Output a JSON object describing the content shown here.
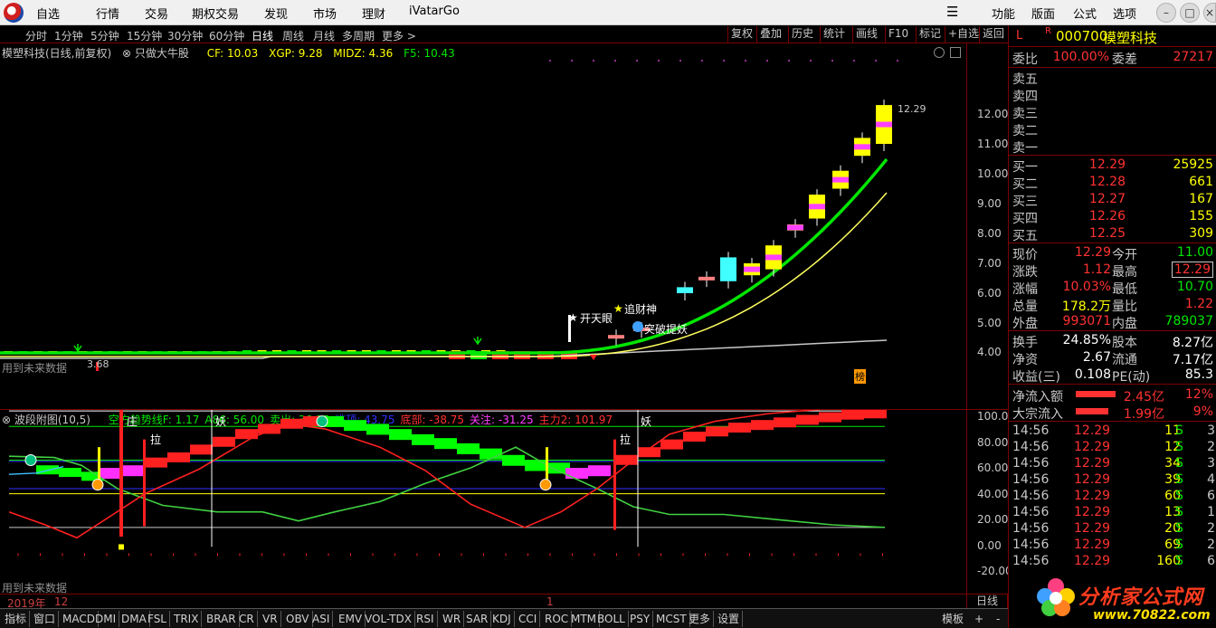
{
  "menu": {
    "items": [
      "自选",
      "行情",
      "交易",
      "期权交易",
      "发现",
      "市场",
      "理财",
      "iVatarGo"
    ],
    "right_items": [
      "功能",
      "版面",
      "公式",
      "选项"
    ]
  },
  "periods": {
    "items": [
      "分时",
      "1分钟",
      "5分钟",
      "15分钟",
      "30分钟",
      "60分钟",
      "日线",
      "周线",
      "月线",
      "多周期",
      "更多 >"
    ],
    "active": "日线"
  },
  "toolbar": [
    "复权",
    "叠加",
    "历史",
    "统计",
    "画线",
    "F10",
    "标记",
    "+自选",
    "返回"
  ],
  "main_chart": {
    "title": "模塑科技(日线,前复权)",
    "formula": "只做大牛股",
    "cf": "CF: 10.03",
    "xgp": "XGP: 9.28",
    "midz": "MIDZ: 4.36",
    "f5": "F5: 10.43",
    "future_note": "用到未来数据",
    "low_label": "3.68",
    "high_label": "12.29",
    "y_labels": [
      "12.00",
      "11.00",
      "10.00",
      "9.00",
      "8.00",
      "7.00",
      "6.00",
      "5.00",
      "4.00"
    ],
    "annotations": [
      "开天眼",
      "追财神",
      "突破提妖",
      "榜"
    ]
  },
  "sub_chart": {
    "title": "波段附图(10,5)",
    "items": [
      {
        "text": "空方趋势线F: 1.17",
        "color": "#00e600"
      },
      {
        "text": "A86: 56.00",
        "color": "#00e600"
      },
      {
        "text": "卖出: 36.25",
        "color": "#00e600"
      },
      {
        "text": "逃顶: 43.75",
        "color": "#3030ff"
      },
      {
        "text": "底部: -38.75",
        "color": "#ff3232"
      },
      {
        "text": "关注: -31.25",
        "color": "#ff40ff"
      },
      {
        "text": "主力2: 101.97",
        "color": "#ff3232"
      }
    ],
    "future_note": "用到未来数据",
    "y_labels": [
      "100.0",
      "80.00",
      "60.00",
      "40.00",
      "20.00",
      "0.00",
      "-20.00"
    ],
    "markers": [
      "庄",
      "拉",
      "妖",
      "拉",
      "妖"
    ]
  },
  "date_strip": {
    "year": "2019年",
    "month": "12",
    "mark": "1",
    "period_tab": "日线"
  },
  "indicators": {
    "items": [
      "指标",
      "窗口",
      "MACD",
      "DMI",
      "DMA",
      "FSL",
      "TRIX",
      "BRAR",
      "CR",
      "VR",
      "OBV",
      "ASI",
      "EMV",
      "VOL-TDX",
      "RSI",
      "WR",
      "SAR",
      "KDJ",
      "CCI",
      "ROC",
      "MTM",
      "BOLL",
      "PSY",
      "MCST",
      "更多",
      "设置"
    ],
    "right": [
      "模板",
      "+",
      "-"
    ]
  },
  "quote": {
    "flag": "L",
    "r": "R",
    "code": "000700",
    "name": "模塑科技",
    "weibi_label": "委比",
    "weibi": "100.00%",
    "weicha_label": "委差",
    "weicha": "27217",
    "asks": [
      {
        "label": "卖五",
        "price": "",
        "vol": ""
      },
      {
        "label": "卖四",
        "price": "",
        "vol": ""
      },
      {
        "label": "卖三",
        "price": "",
        "vol": ""
      },
      {
        "label": "卖二",
        "price": "",
        "vol": ""
      },
      {
        "label": "卖一",
        "price": "",
        "vol": ""
      }
    ],
    "bids": [
      {
        "label": "买一",
        "price": "12.29",
        "vol": "25925"
      },
      {
        "label": "买二",
        "price": "12.28",
        "vol": "661"
      },
      {
        "label": "买三",
        "price": "12.27",
        "vol": "167"
      },
      {
        "label": "买四",
        "price": "12.26",
        "vol": "155"
      },
      {
        "label": "买五",
        "price": "12.25",
        "vol": "309"
      }
    ],
    "stats": [
      {
        "l1": "现价",
        "v1": "12.29",
        "c1": "red",
        "l2": "今开",
        "v2": "11.00",
        "c2": "green"
      },
      {
        "l1": "涨跌",
        "v1": "1.12",
        "c1": "red",
        "l2": "最高",
        "v2": "12.29",
        "c2": "red"
      },
      {
        "l1": "涨幅",
        "v1": "10.03%",
        "c1": "red",
        "l2": "最低",
        "v2": "10.70",
        "c2": "green"
      },
      {
        "l1": "总量",
        "v1": "178.2万",
        "c1": "yellow",
        "l2": "量比",
        "v2": "1.22",
        "c2": "red"
      },
      {
        "l1": "外盘",
        "v1": "993071",
        "c1": "red",
        "l2": "内盘",
        "v2": "789037",
        "c2": "green"
      }
    ],
    "stats2": [
      {
        "l1": "换手",
        "v1": "24.85%",
        "l2": "股本",
        "v2": "8.27亿"
      },
      {
        "l1": "净资",
        "v1": "2.67",
        "l2": "流通",
        "v2": "7.17亿"
      },
      {
        "l1": "收益(三)",
        "v1": "0.108",
        "l2": "PE(动)",
        "v2": "85.3"
      }
    ],
    "flows": [
      {
        "label": "净流入额",
        "value": "2.45亿",
        "pct": "12%"
      },
      {
        "label": "大宗流入",
        "value": "1.99亿",
        "pct": "9%"
      }
    ],
    "ticks": [
      {
        "time": "14:56",
        "price": "12.29",
        "qty": "11",
        "side": "S",
        "n": "3"
      },
      {
        "time": "14:56",
        "price": "12.29",
        "qty": "12",
        "side": "S",
        "n": "2"
      },
      {
        "time": "14:56",
        "price": "12.29",
        "qty": "34",
        "side": "S",
        "n": "3"
      },
      {
        "time": "14:56",
        "price": "12.29",
        "qty": "39",
        "side": "S",
        "n": "4"
      },
      {
        "time": "14:56",
        "price": "12.29",
        "qty": "60",
        "side": "S",
        "n": "6"
      },
      {
        "time": "14:56",
        "price": "12.29",
        "qty": "13",
        "side": "S",
        "n": "1"
      },
      {
        "time": "14:56",
        "price": "12.29",
        "qty": "20",
        "side": "S",
        "n": "2"
      },
      {
        "time": "14:56",
        "price": "12.29",
        "qty": "69",
        "side": "S",
        "n": "2"
      },
      {
        "time": "14:56",
        "price": "12.29",
        "qty": "160",
        "side": "S",
        "n": "6"
      }
    ]
  },
  "watermark": {
    "line1": "分析家公式网",
    "line2": "www.70822.com"
  },
  "colors": {
    "bg": "#000000",
    "up": "#ff3232",
    "down": "#00e600",
    "frame": "#7a0000"
  }
}
